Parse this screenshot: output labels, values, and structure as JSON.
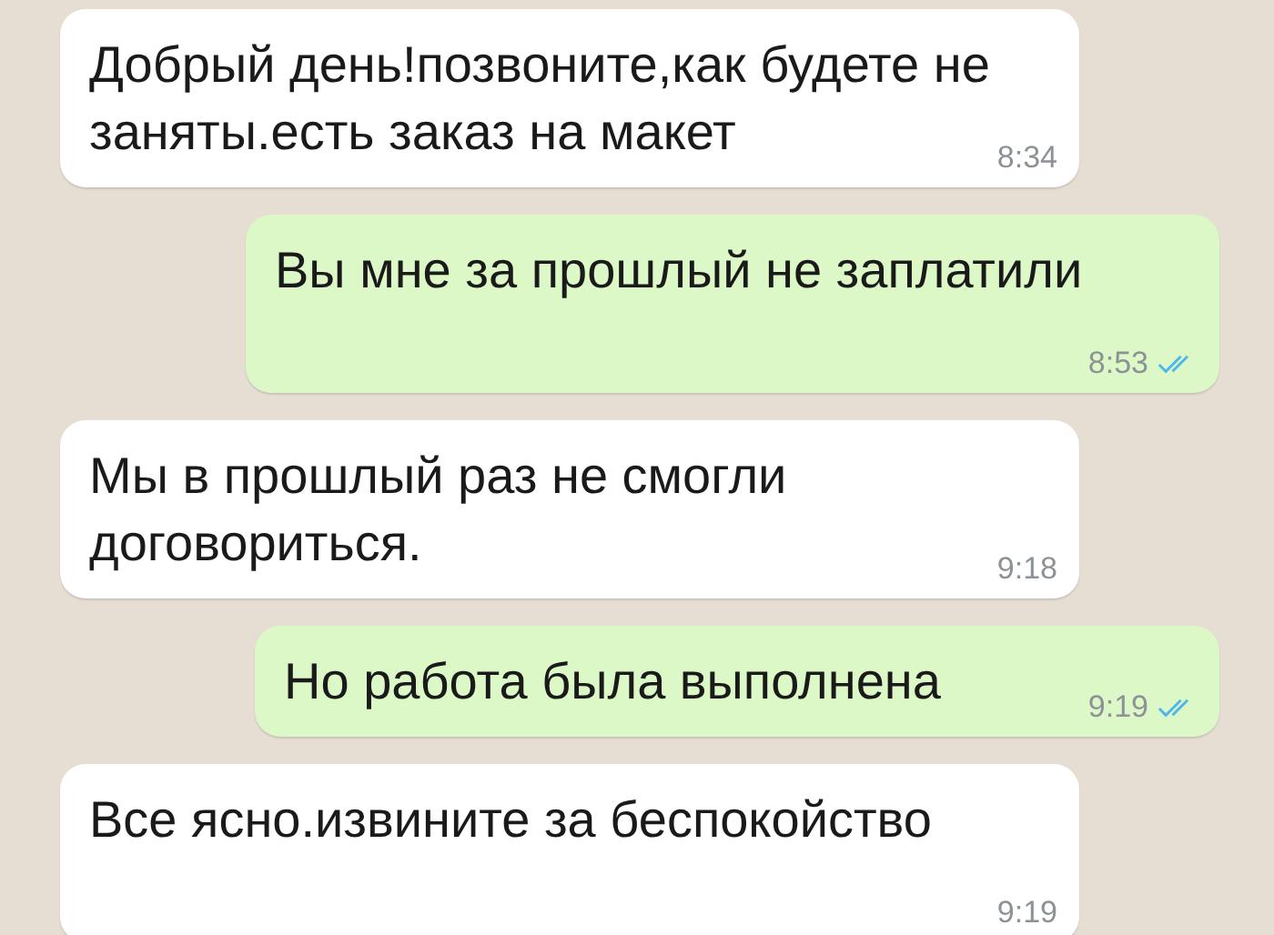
{
  "messages": [
    {
      "kind": "incoming",
      "text": "Добрый день!позвоните,как будете не заняты.есть заказ на макет",
      "time": "8:34"
    },
    {
      "kind": "outgoing",
      "text": "Вы мне за прошлый не заплатили",
      "time": "8:53",
      "read": true
    },
    {
      "kind": "incoming",
      "text": "Мы в прошлый раз не смогли договориться.",
      "time": "9:18"
    },
    {
      "kind": "outgoing",
      "text": "Но работа была выполнена",
      "time": "9:19",
      "read": true
    },
    {
      "kind": "incoming",
      "text": "Все ясно.извините за беспокойство",
      "time": "9:19"
    }
  ]
}
